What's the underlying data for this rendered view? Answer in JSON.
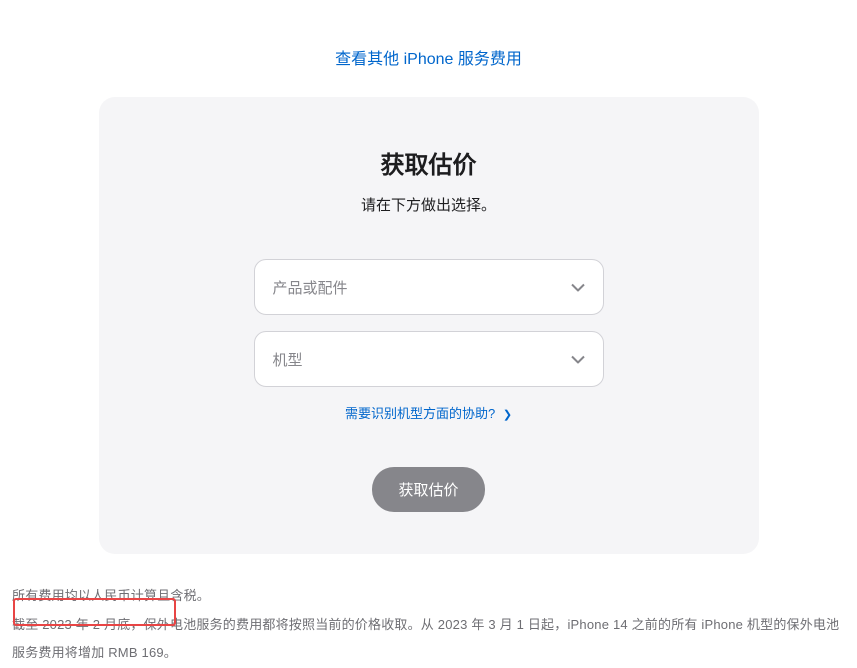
{
  "header": {
    "link_text": "查看其他 iPhone 服务费用"
  },
  "card": {
    "title": "获取估价",
    "subtitle": "请在下方做出选择。",
    "select_product_placeholder": "产品或配件",
    "select_model_placeholder": "机型",
    "help_link_text": "需要识别机型方面的协助?",
    "button_label": "获取估价"
  },
  "footer": {
    "line1": "所有费用均以人民币计算且含税。",
    "line2": "截至 2023 年 2 月底，保外电池服务的费用都将按照当前的价格收取。从 2023 年 3 月 1 日起，iPhone 14 之前的所有 iPhone 机型的保外电池服务费用将增加 RMB 169。"
  }
}
